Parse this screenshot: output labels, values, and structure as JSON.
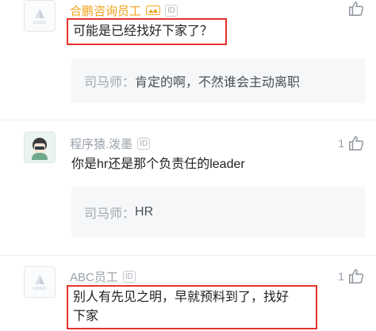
{
  "comments": [
    {
      "username": "合鹏咨询员工",
      "id_badge": "ID",
      "avatar_text": "LOGO",
      "like_count": "",
      "content": "可能是已经找好下家了？",
      "reply": {
        "author": "司马师：",
        "text": "肯定的啊，不然谁会主动离职"
      }
    },
    {
      "username": "程序猿.泼墨",
      "id_badge": "ID",
      "like_count": "1",
      "content": "你是hr还是那个负责任的leader",
      "reply": {
        "author": "司马师：",
        "text": "HR"
      }
    },
    {
      "username": "ABC员工",
      "id_badge": "ID",
      "avatar_text": "LOGO",
      "like_count": "1",
      "content_line1": "别人有先见之明，早就预料到了，找好",
      "content_line2": "下家"
    }
  ],
  "colors": {
    "highlight": "#e5322e",
    "vip_name": "#f3a21b",
    "muted": "#9aa1ab"
  }
}
